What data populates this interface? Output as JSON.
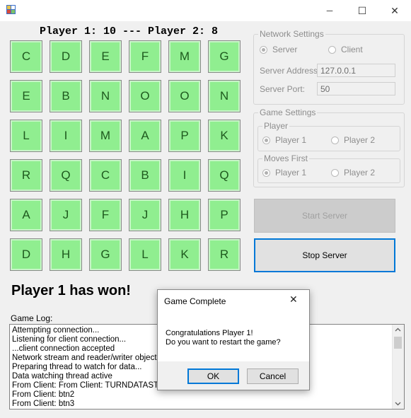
{
  "window": {
    "minimize_glyph": "─",
    "maximize_glyph": "☐",
    "close_glyph": "✕",
    "icon": "app-icon"
  },
  "score": {
    "text": "Player 1: 10 --- Player 2: 8"
  },
  "board": {
    "rows": [
      [
        "C",
        "D",
        "E",
        "F",
        "M",
        "G"
      ],
      [
        "E",
        "B",
        "N",
        "O",
        "O",
        "N"
      ],
      [
        "L",
        "I",
        "M",
        "A",
        "P",
        "K"
      ],
      [
        "R",
        "Q",
        "C",
        "B",
        "I",
        "Q"
      ],
      [
        "A",
        "J",
        "F",
        "J",
        "H",
        "P"
      ],
      [
        "D",
        "H",
        "G",
        "L",
        "K",
        "R"
      ]
    ],
    "tile_color": "#90ee90"
  },
  "network": {
    "title": "Network Settings",
    "server_label": "Server",
    "client_label": "Client",
    "selected": "Server",
    "address_label": "Server Address:",
    "address_value": "127.0.0.1",
    "port_label": "Server Port:",
    "port_value": "50"
  },
  "game_settings": {
    "title": "Game Settings",
    "player_title": "Player",
    "player1_label": "Player 1",
    "player2_label": "Player 2",
    "player_selected": "Player 1",
    "moves_title": "Moves First",
    "moves1_label": "Player 1",
    "moves2_label": "Player 2",
    "moves_selected": "Player 1"
  },
  "buttons": {
    "start_label": "Start Server",
    "stop_label": "Stop Server"
  },
  "status": {
    "won_text": "Player 1 has won!"
  },
  "log": {
    "label": "Game Log:",
    "lines": [
      "Attempting connection...",
      "Listening for client connection...",
      "...client connection accepted",
      "Network stream and reader/writer objects created",
      "Preparing thread to watch for data...",
      "Data watching thread active",
      "From Client: From Client: TURNDATASTART",
      "From Client: btn2",
      "From Client: btn3"
    ]
  },
  "dialog": {
    "title": "Game Complete",
    "line1": "Congratulations Player 1!",
    "line2": "Do you want to restart the game?",
    "ok_label": "OK",
    "cancel_label": "Cancel",
    "close_glyph": "✕"
  }
}
